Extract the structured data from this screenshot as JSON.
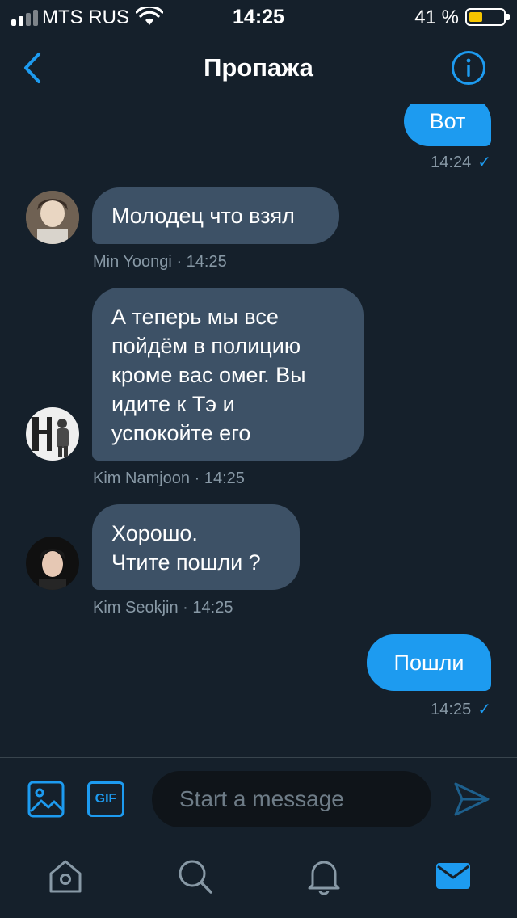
{
  "status_bar": {
    "carrier": "MTS RUS",
    "time": "14:25",
    "battery": "41 %",
    "battery_level": 0.41,
    "signal_icon": "signal-bars-icon",
    "wifi_icon": "wifi-icon"
  },
  "header": {
    "title": "Пропажа",
    "back_icon": "chevron-left-icon",
    "info_icon": "info-circle-icon"
  },
  "messages": [
    {
      "direction": "outgoing",
      "text": "Вот",
      "time": "14:24",
      "status": "✓"
    },
    {
      "direction": "incoming",
      "text": "Молодец что взял",
      "sender": "Min Yoongi",
      "separator": "·",
      "time": "14:25"
    },
    {
      "direction": "incoming",
      "lines": [
        "А теперь мы все",
        "пойдём в полицию",
        "кроме вас омег. Вы",
        "идите к Тэ и",
        "успокойте его"
      ],
      "sender": "Kim Namjoon",
      "separator": "·",
      "time": "14:25"
    },
    {
      "direction": "incoming",
      "lines": [
        "Хорошо.",
        "Чтите пошли ?"
      ],
      "sender": "Kim Seokjin",
      "separator": "·",
      "time": "14:25"
    },
    {
      "direction": "outgoing",
      "text": "Пошли",
      "time": "14:25",
      "status": "✓"
    }
  ],
  "composer": {
    "placeholder": "Start a message",
    "value": "",
    "gif_label": "GIF",
    "media_icon": "image-icon",
    "send_icon": "send-icon"
  },
  "tab_bar": {
    "items": [
      {
        "icon": "home-icon",
        "active": false
      },
      {
        "icon": "search-icon",
        "active": false
      },
      {
        "icon": "bell-icon",
        "active": false
      },
      {
        "icon": "mail-icon",
        "active": true
      }
    ]
  },
  "colors": {
    "background": "#15202b",
    "accent": "#1d9bf0",
    "incoming_bubble": "#3d5166",
    "muted_text": "#8899a6",
    "divider": "#38444d",
    "battery_fill": "#f7c600"
  }
}
